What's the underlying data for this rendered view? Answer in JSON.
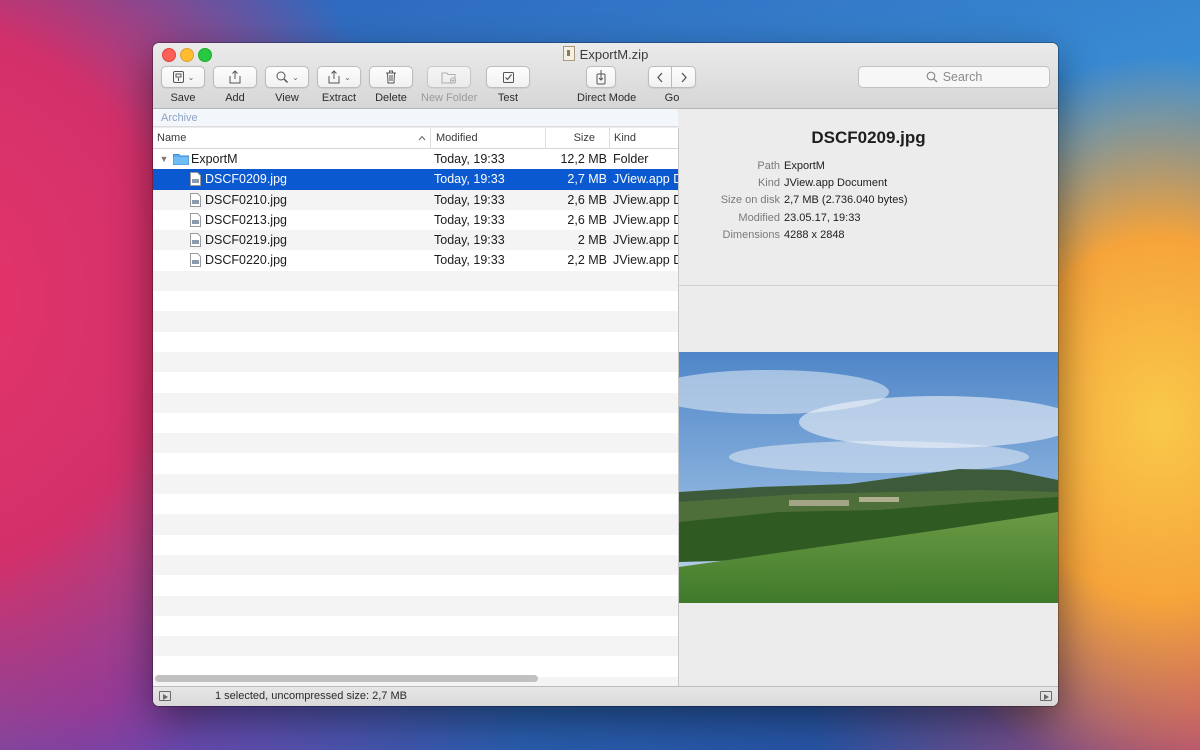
{
  "window": {
    "title": "ExportM.zip"
  },
  "toolbar": {
    "save_label": "Save",
    "add_label": "Add",
    "view_label": "View",
    "extract_label": "Extract",
    "delete_label": "Delete",
    "new_folder_label": "New Folder",
    "test_label": "Test",
    "direct_mode_label": "Direct Mode",
    "go_label": "Go"
  },
  "search": {
    "placeholder": "Search"
  },
  "pathbar": {
    "label": "Archive"
  },
  "list": {
    "columns": {
      "name": "Name",
      "modified": "Modified",
      "size": "Size",
      "kind": "Kind"
    },
    "rows": [
      {
        "name": "ExportM",
        "modified": "Today, 19:33",
        "size": "12,2 MB",
        "kind": "Folder"
      },
      {
        "name": "DSCF0209.jpg",
        "modified": "Today, 19:33",
        "size": "2,7 MB",
        "kind": "JView.app Document"
      },
      {
        "name": "DSCF0210.jpg",
        "modified": "Today, 19:33",
        "size": "2,6 MB",
        "kind": "JView.app Document"
      },
      {
        "name": "DSCF0213.jpg",
        "modified": "Today, 19:33",
        "size": "2,6 MB",
        "kind": "JView.app Document"
      },
      {
        "name": "DSCF0219.jpg",
        "modified": "Today, 19:33",
        "size": "2 MB",
        "kind": "JView.app Document"
      },
      {
        "name": "DSCF0220.jpg",
        "modified": "Today, 19:33",
        "size": "2,2 MB",
        "kind": "JView.app Document"
      }
    ]
  },
  "info": {
    "title": "DSCF0209.jpg",
    "path_label": "Path",
    "path_value": "ExportM",
    "kind_label": "Kind",
    "kind_value": "JView.app Document",
    "size_label": "Size on disk",
    "size_value": "2,7 MB (2.736.040 bytes)",
    "modified_label": "Modified",
    "modified_value": "23.05.17, 19:33",
    "dimensions_label": "Dimensions",
    "dimensions_value": "4288 x 2848"
  },
  "status": {
    "text": "1 selected, uncompressed size: 2,7 MB"
  },
  "colors": {
    "selection": "#0a59d0",
    "folder": "#5aaef0"
  }
}
